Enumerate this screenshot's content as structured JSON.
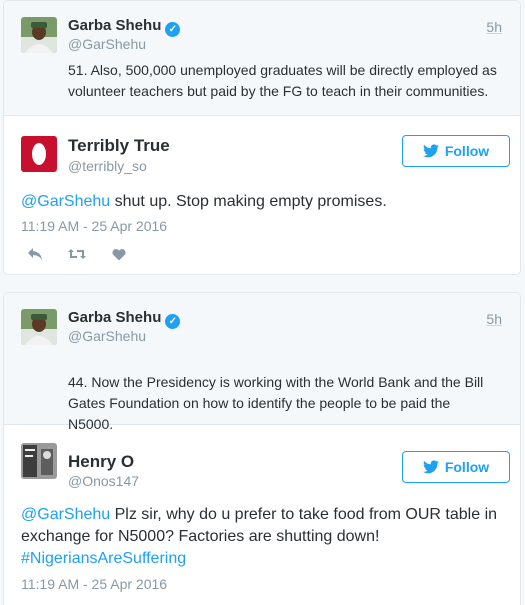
{
  "tweets": [
    {
      "quoted": {
        "name": "Garba Shehu",
        "handle": "@GarShehu",
        "time": "5h",
        "text": "51. Also, 500,000 unemployed graduates will be directly employed as volunteer teachers but paid by the FG to teach in their communities."
      },
      "reply": {
        "name": "Terribly True",
        "handle": "@terribly_so",
        "follow_label": "Follow",
        "mention": "@GarShehu",
        "text": " shut up. Stop making empty promises.",
        "timestamp": "11:19 AM - 25 Apr 2016"
      }
    },
    {
      "quoted": {
        "name": "Garba Shehu",
        "handle": "@GarShehu",
        "time": "5h",
        "text": "44. Now the Presidency is working with the World Bank and the Bill Gates Foundation on how to identify the people to be paid the N5000."
      },
      "reply": {
        "name": "Henry O",
        "handle": "@Onos147",
        "follow_label": "Follow",
        "mention": "@GarShehu",
        "text": " Plz sir, why do u prefer to take food from OUR table in exchange for N5000? Factories are shutting down!",
        "hashtag": "#NigeriansAreSuffering",
        "timestamp": "11:19 AM - 25 Apr 2016"
      }
    }
  ],
  "colors": {
    "accent": "#1da1f2",
    "muted": "#8899a6",
    "text": "#292f33",
    "quote_bg": "#f5f8fa"
  }
}
